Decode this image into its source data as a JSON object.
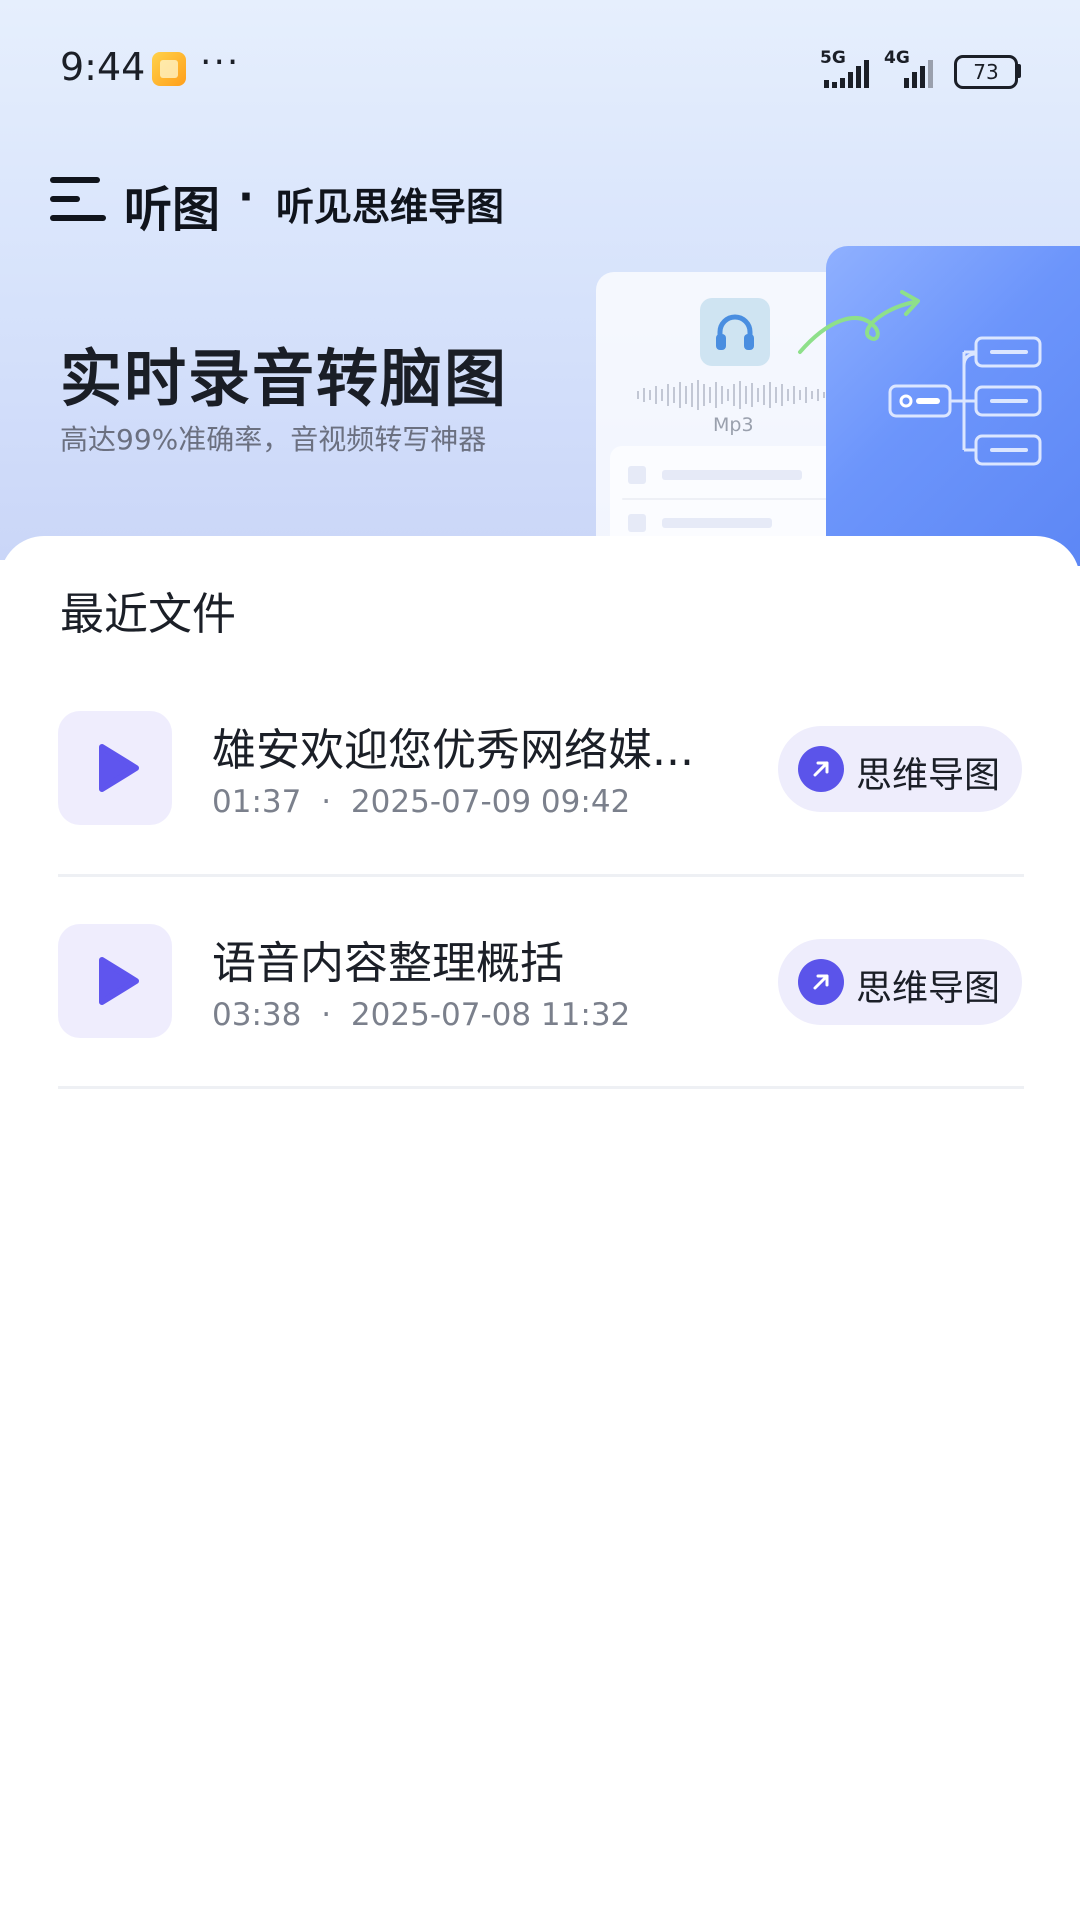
{
  "status_bar": {
    "time": "9:44",
    "more": "···",
    "signal_1": "5G",
    "signal_2": "4G",
    "battery": "73",
    "app_icon": "notes-app-icon"
  },
  "header": {
    "menu_icon": "menu-icon",
    "app_name": "听图",
    "separator": "·",
    "tagline": "听见思维导图"
  },
  "hero": {
    "title": "实时录音转脑图",
    "subtitle": "高达99%准确率，音视频转写神器",
    "illustration_label": "Mp3"
  },
  "recent": {
    "section_title": "最近文件",
    "files": [
      {
        "title": "雄安欢迎您优秀网络媒...",
        "duration": "01:37",
        "datetime": "2025-07-09 09:42",
        "action_label": "思维导图"
      },
      {
        "title": "语音内容整理概括",
        "duration": "03:38",
        "datetime": "2025-07-08 11:32",
        "action_label": "思维导图"
      }
    ],
    "meta_separator": "·"
  },
  "colors": {
    "accent": "#5b54ea",
    "play_icon": "#5f55ee",
    "thumb_bg": "#efedfd",
    "button_bg": "#eeedfc"
  }
}
